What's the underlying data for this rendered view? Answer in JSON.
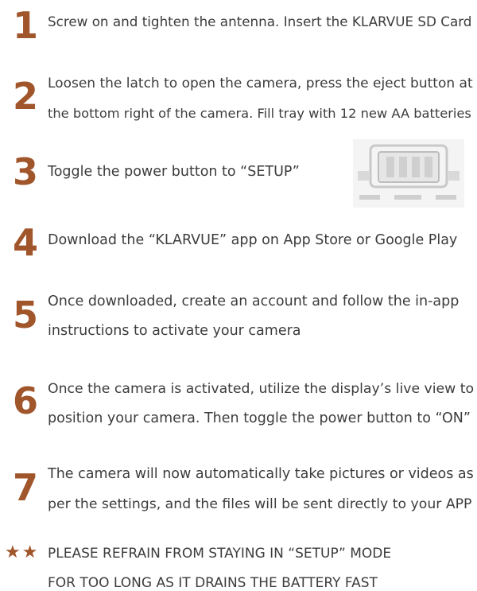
{
  "steps": [
    {
      "number": "1",
      "lines": [
        "Screw on and tighten the antenna. Insert the KLARVUE SD Card"
      ]
    },
    {
      "number": "2",
      "lines": [
        "Loosen the latch to open the camera, press the eject button at",
        "the bottom right of the camera. Fill tray with 12 new AA batteries"
      ]
    },
    {
      "number": "3",
      "lines": [
        "Toggle the power button to “SETUP”"
      ]
    },
    {
      "number": "4",
      "lines": [
        "Download the “KLARVUE” app on App Store or Google Play"
      ]
    },
    {
      "number": "5",
      "lines": [
        "Once downloaded, create an account and follow the in-app",
        "instructions to activate your camera"
      ]
    },
    {
      "number": "6",
      "lines": [
        "Once the camera is activated, utilize the display’s live view to",
        "position your camera. Then toggle the power button to “ON”"
      ]
    },
    {
      "number": "7",
      "lines": [
        "The camera will now automatically take pictures or videos as",
        "per the settings, and the files will be sent directly to your APP"
      ]
    }
  ],
  "note": {
    "stars": "★★",
    "lines": [
      "PLEASE REFRAIN FROM STAYING IN “SETUP” MODE",
      "FOR TOO LONG AS IT DRAINS THE BATTERY FAST"
    ]
  },
  "colors": {
    "accent": "#a0552a",
    "text": "#3c3c3c"
  },
  "icons": {
    "power-switch-illustration": "power-switch-setup-icon"
  }
}
